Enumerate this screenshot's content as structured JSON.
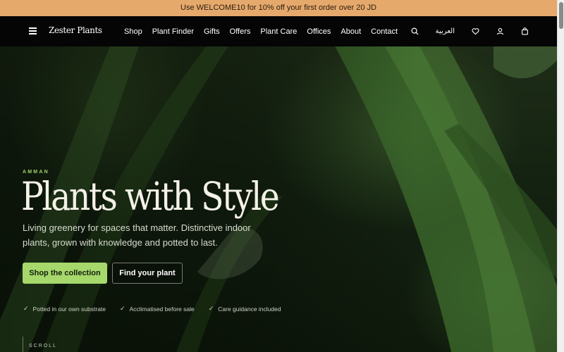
{
  "announcement": {
    "text": "Use WELCOME10 for 10% off your first order over 20 JD"
  },
  "header": {
    "menu_icon": "hamburger-menu-icon",
    "logo": "Zester Plants",
    "nav_links": [
      "Shop",
      "Plant Finder",
      "Gifts",
      "Offers",
      "Plant Care",
      "Offices",
      "About",
      "Contact"
    ],
    "language_label": "العربية",
    "icons": [
      "search-icon",
      "heart-icon",
      "user-icon",
      "bag-icon"
    ]
  },
  "hero": {
    "eyebrow": "AMMAN",
    "headline": "Plants with Style",
    "subtitle": "Living greenery for spaces that matter. Distinctive indoor plants, grown with knowledge and potted to last.",
    "primary_cta": "Shop the collection",
    "secondary_cta": "Find your plant",
    "features": [
      "Potted in our own substrate",
      "Acclimatised before sale",
      "Care guidance included"
    ],
    "scroll_label": "SCROLL"
  },
  "colors": {
    "announcement_bg": "#e6a96c",
    "nav_bg": "#050505",
    "accent_green": "#a6d86c",
    "hero_text": "#f4f1e6"
  }
}
